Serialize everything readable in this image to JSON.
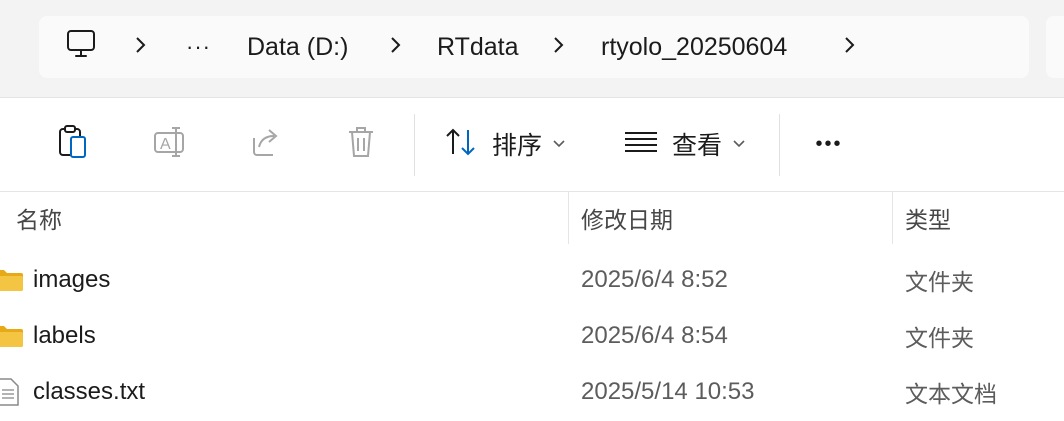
{
  "address_bar": {
    "computer_icon": "monitor-icon",
    "overflow": "···",
    "crumbs": [
      "Data (D:)",
      "RTdata",
      "rtyolo_20250604"
    ]
  },
  "toolbar": {
    "sort_label": "排序",
    "view_label": "查看",
    "more": "•••"
  },
  "columns": {
    "name": "名称",
    "date": "修改日期",
    "type": "类型"
  },
  "files": [
    {
      "name": "images",
      "date": "2025/6/4 8:52",
      "type": "文件夹",
      "icon": "folder-icon"
    },
    {
      "name": "labels",
      "date": "2025/6/4 8:54",
      "type": "文件夹",
      "icon": "folder-icon"
    },
    {
      "name": "classes.txt",
      "date": "2025/5/14 10:53",
      "type": "文本文档",
      "icon": "text-file-icon"
    }
  ],
  "colors": {
    "accent": "#0067c0",
    "folder": "#f4c542",
    "disabled_icon": "#a6a6a6"
  }
}
